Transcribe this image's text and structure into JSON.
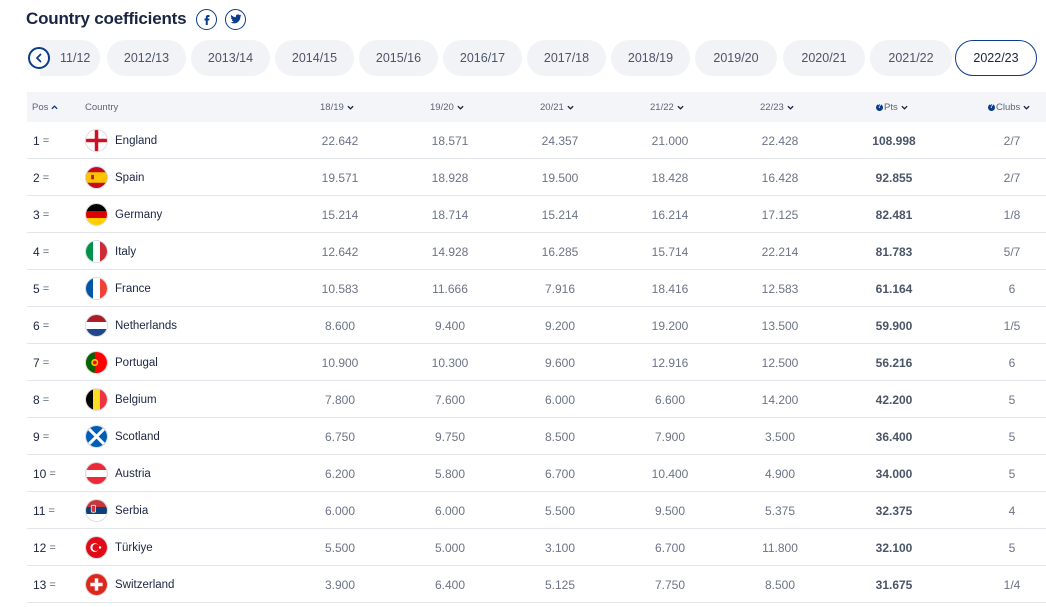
{
  "header": {
    "title": "Country coefficients"
  },
  "seasons": [
    "11/12",
    "2012/13",
    "2013/14",
    "2014/15",
    "2015/16",
    "2016/17",
    "2017/18",
    "2018/19",
    "2019/20",
    "2020/21",
    "2021/22",
    "2022/23"
  ],
  "active_season": "2022/23",
  "table": {
    "headers": {
      "pos": "Pos",
      "country": "Country",
      "y1": "18/19",
      "y2": "19/20",
      "y3": "20/21",
      "y4": "21/22",
      "y5": "22/23",
      "pts": "Pts",
      "clubs": "Clubs"
    },
    "rows": [
      {
        "pos": "1",
        "change": "=",
        "country": "England",
        "y1": "22.642",
        "y2": "18.571",
        "y3": "24.357",
        "y4": "21.000",
        "y5": "22.428",
        "pts": "108.998",
        "clubs": "2/7"
      },
      {
        "pos": "2",
        "change": "=",
        "country": "Spain",
        "y1": "19.571",
        "y2": "18.928",
        "y3": "19.500",
        "y4": "18.428",
        "y5": "16.428",
        "pts": "92.855",
        "clubs": "2/7"
      },
      {
        "pos": "3",
        "change": "=",
        "country": "Germany",
        "y1": "15.214",
        "y2": "18.714",
        "y3": "15.214",
        "y4": "16.214",
        "y5": "17.125",
        "pts": "82.481",
        "clubs": "1/8"
      },
      {
        "pos": "4",
        "change": "=",
        "country": "Italy",
        "y1": "12.642",
        "y2": "14.928",
        "y3": "16.285",
        "y4": "15.714",
        "y5": "22.214",
        "pts": "81.783",
        "clubs": "5/7"
      },
      {
        "pos": "5",
        "change": "=",
        "country": "France",
        "y1": "10.583",
        "y2": "11.666",
        "y3": "7.916",
        "y4": "18.416",
        "y5": "12.583",
        "pts": "61.164",
        "clubs": "6"
      },
      {
        "pos": "6",
        "change": "=",
        "country": "Netherlands",
        "y1": "8.600",
        "y2": "9.400",
        "y3": "9.200",
        "y4": "19.200",
        "y5": "13.500",
        "pts": "59.900",
        "clubs": "1/5"
      },
      {
        "pos": "7",
        "change": "=",
        "country": "Portugal",
        "y1": "10.900",
        "y2": "10.300",
        "y3": "9.600",
        "y4": "12.916",
        "y5": "12.500",
        "pts": "56.216",
        "clubs": "6"
      },
      {
        "pos": "8",
        "change": "=",
        "country": "Belgium",
        "y1": "7.800",
        "y2": "7.600",
        "y3": "6.000",
        "y4": "6.600",
        "y5": "14.200",
        "pts": "42.200",
        "clubs": "5"
      },
      {
        "pos": "9",
        "change": "=",
        "country": "Scotland",
        "y1": "6.750",
        "y2": "9.750",
        "y3": "8.500",
        "y4": "7.900",
        "y5": "3.500",
        "pts": "36.400",
        "clubs": "5"
      },
      {
        "pos": "10",
        "change": "=",
        "country": "Austria",
        "y1": "6.200",
        "y2": "5.800",
        "y3": "6.700",
        "y4": "10.400",
        "y5": "4.900",
        "pts": "34.000",
        "clubs": "5"
      },
      {
        "pos": "11",
        "change": "=",
        "country": "Serbia",
        "y1": "6.000",
        "y2": "6.000",
        "y3": "5.500",
        "y4": "9.500",
        "y5": "5.375",
        "pts": "32.375",
        "clubs": "4"
      },
      {
        "pos": "12",
        "change": "=",
        "country": "Türkiye",
        "y1": "5.500",
        "y2": "5.000",
        "y3": "3.100",
        "y4": "6.700",
        "y5": "11.800",
        "pts": "32.100",
        "clubs": "5"
      },
      {
        "pos": "13",
        "change": "=",
        "country": "Switzerland",
        "y1": "3.900",
        "y2": "6.400",
        "y3": "5.125",
        "y4": "7.750",
        "y5": "8.500",
        "pts": "31.675",
        "clubs": "1/4"
      }
    ]
  },
  "colors": {
    "accent": "#0b3c8c",
    "pill_bg": "#f2f3f6",
    "header_bg": "#f4f5f8"
  },
  "icons": {
    "facebook": "facebook-icon",
    "twitter": "twitter-icon",
    "back": "chevron-left-icon",
    "sort": "chevron-down-icon"
  }
}
